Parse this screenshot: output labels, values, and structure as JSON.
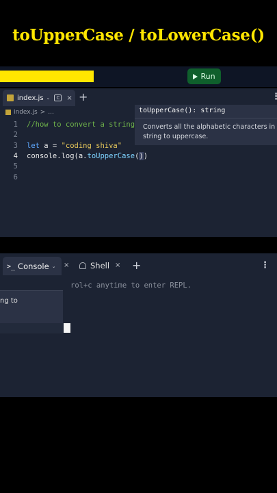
{
  "header": {
    "title": "toUpperCase / toLowerCase()"
  },
  "toolbar": {
    "run_label": "Run"
  },
  "editor": {
    "tab": {
      "filename": "index.js",
      "chevron": "⌄",
      "file_icon": "C",
      "close": "×"
    },
    "add_tab": "+",
    "menu": "⋮",
    "breadcrumb": {
      "file": "index.js",
      "sep": ">",
      "more": "..."
    },
    "lines": [
      {
        "num": "1",
        "parts": [
          {
            "t": "//how to convert a string",
            "c": "c-comment"
          }
        ]
      },
      {
        "num": "2",
        "parts": []
      },
      {
        "num": "3",
        "parts": [
          {
            "t": "let",
            "c": "c-kw"
          },
          {
            "t": " a = ",
            "c": ""
          },
          {
            "t": "\"coding shiva\"",
            "c": "c-str"
          }
        ]
      },
      {
        "num": "4",
        "active": true,
        "parts": [
          {
            "t": "console.log(a.",
            "c": ""
          },
          {
            "t": "toUpperCase",
            "c": "c-fn"
          },
          {
            "t": "(",
            "c": ""
          },
          {
            "t": ")",
            "c": "c-paren"
          },
          {
            "t": ")",
            "c": ""
          }
        ]
      },
      {
        "num": "5",
        "parts": []
      },
      {
        "num": "6",
        "parts": []
      }
    ]
  },
  "tooltip": {
    "signature": "toUpperCase(): string",
    "description": "Converts all the alphabetic characters in a string to uppercase."
  },
  "console": {
    "tab_prompt": ">_",
    "tab_label": "Console",
    "tab_chevron": "⌄",
    "close": "×",
    "shell_label": "Shell",
    "shell_close": "×",
    "add_tab": "+",
    "menu": "⋮",
    "hint_text": "rol+c anytime to enter REPL.",
    "popup_text": "ng to"
  },
  "colors": {
    "accent": "#ffe600",
    "run_button": "#0f5f2c",
    "panel_bg": "#1c2333",
    "tab_bg": "#2b3245"
  }
}
